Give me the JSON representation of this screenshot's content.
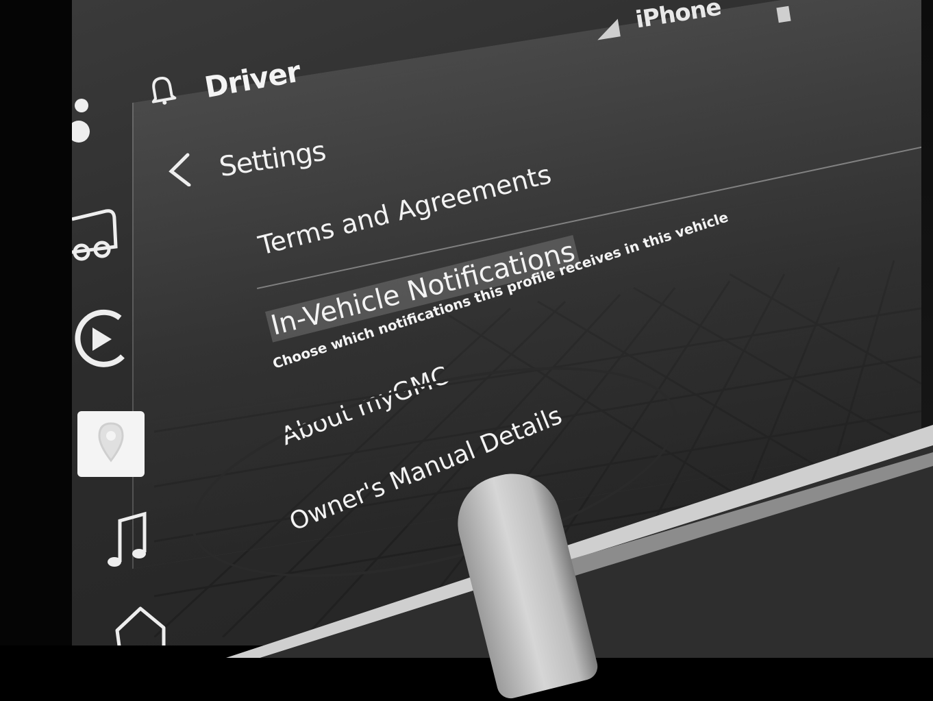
{
  "status_bar": {
    "signal_icon": "signal-icon",
    "phone_label": "iPhone",
    "battery_icon": "battery-icon"
  },
  "header": {
    "bell_icon": "bell-icon",
    "profile_label": "Driver"
  },
  "sidebar": {
    "items": [
      {
        "icon": "apps-icon"
      },
      {
        "icon": "vehicle-icon"
      },
      {
        "icon": "media-play-icon"
      },
      {
        "icon": "navigation-pin-icon",
        "active": true
      },
      {
        "icon": "music-icon"
      },
      {
        "icon": "home-icon"
      }
    ]
  },
  "panel": {
    "back_icon": "chevron-left-icon",
    "title": "Settings",
    "items": [
      {
        "label": "Terms and Agreements"
      },
      {
        "label": "In-Vehicle Notifications",
        "subtitle": "Choose which notifications this profile receives in this vehicle",
        "highlighted": true
      },
      {
        "label": "About myGMC"
      },
      {
        "label": "Owner's Manual Details"
      }
    ]
  },
  "colors": {
    "screen_background": "#2c2c2c",
    "text": "#f2f2f2",
    "highlight": "#969696",
    "annotation_ellipse": "#2a2a2a"
  }
}
